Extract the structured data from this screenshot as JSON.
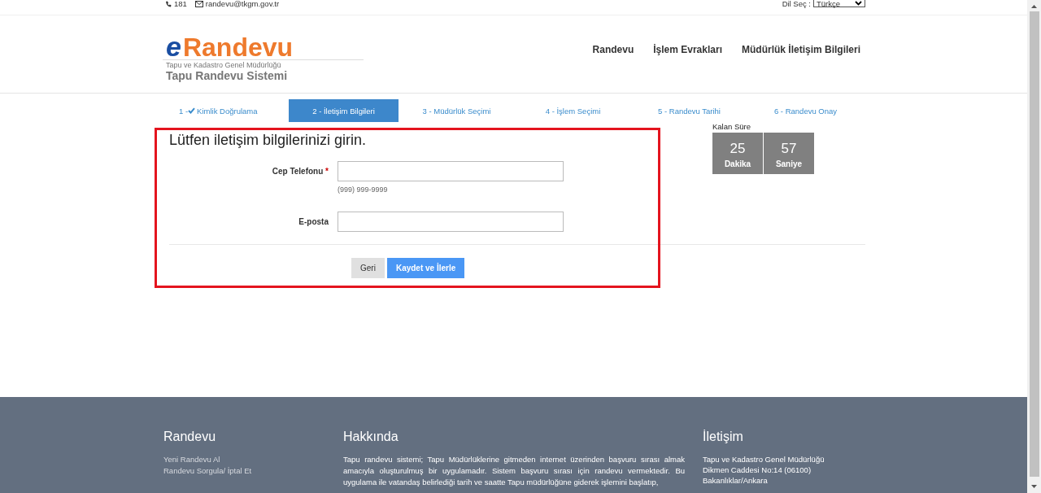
{
  "top_bar": {
    "phone": "181",
    "email": "randevu@tkgm.gov.tr",
    "language_label": "Dil Seç :",
    "language_value": "Türkçe"
  },
  "logo": {
    "letter": "e",
    "word": "Randevu",
    "subtitle": "Tapu ve Kadastro Genel Müdürlüğü",
    "system": "Tapu Randevu Sistemi"
  },
  "nav": [
    "Randevu",
    "İşlem Evrakları",
    "Müdürlük İletişim Bilgileri"
  ],
  "steps": [
    {
      "label": "1 - ",
      "text": "Kimlik Doğrulama",
      "done": true,
      "selected": false
    },
    {
      "label": "2 - ",
      "text": "İletişim Bilgileri",
      "done": false,
      "selected": true
    },
    {
      "label": "3 - ",
      "text": "Müdürlük Seçimi",
      "done": false,
      "selected": false
    },
    {
      "label": "4 - ",
      "text": "İşlem Seçimi",
      "done": false,
      "selected": false
    },
    {
      "label": "5 - ",
      "text": "Randevu Tarihi",
      "done": false,
      "selected": false
    },
    {
      "label": "6 - ",
      "text": "Randevu Onay",
      "done": false,
      "selected": false
    }
  ],
  "form": {
    "title": "Lütfen iletişim bilgilerinizi girin.",
    "fields": [
      {
        "label": "Cep Telefonu",
        "required": true,
        "hint": "(999) 999-9999"
      },
      {
        "label": "E-posta",
        "required": false
      }
    ],
    "required_mark": "*",
    "buttons": [
      {
        "label": "Geri",
        "kind": "secondary"
      },
      {
        "label": "Kaydet ve İlerle",
        "kind": "primary"
      }
    ]
  },
  "timer": {
    "title": "Kalan Süre",
    "boxes": [
      {
        "value": "25",
        "unit": "Dakika"
      },
      {
        "value": "57",
        "unit": "Saniye"
      }
    ]
  },
  "footer": {
    "columns": [
      {
        "heading": "Randevu",
        "links": [
          "Yeni Randevu Al",
          "Randevu Sorgula/ İptal Et"
        ]
      },
      {
        "heading": "Hakkında",
        "paragraph": "Tapu randevu sistemi; Tapu Müdürlüklerine gitmeden internet üzerinden başvuru sırası almak amacıyla oluşturulmuş bir uygulamadır. Sistem başvuru sırası için randevu vermektedir. Bu uygulama ile vatandaş belirlediği tarih ve saatte Tapu müdürlüğüne giderek işlemini başlatıp,"
      },
      {
        "heading": "İletişim",
        "lines": [
          "Tapu ve Kadastro Genel Müdürlüğü",
          "Dikmen Caddesi No:14 (06100)",
          "Bakanlıklar/Ankara"
        ]
      }
    ]
  }
}
